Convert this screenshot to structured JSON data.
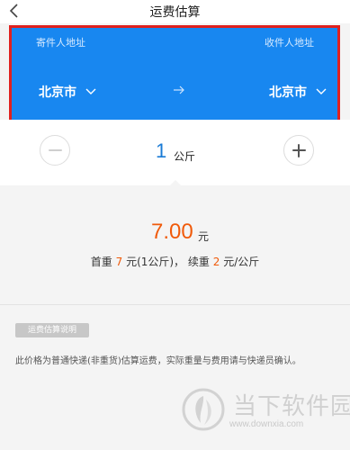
{
  "header": {
    "title": "运费估算"
  },
  "sender": {
    "label": "寄件人地址",
    "city": "北京市"
  },
  "receiver": {
    "label": "收件人地址",
    "city": "北京市"
  },
  "weight": {
    "value": "1",
    "unit": "公斤"
  },
  "result": {
    "price": "7.00",
    "price_unit": "元",
    "first_weight_label": "首重",
    "first_weight_price": "7",
    "first_weight_unit": "元(1公斤)，",
    "extra_weight_label": "续重",
    "extra_weight_price": "2",
    "extra_weight_unit": "元/公斤"
  },
  "notice": {
    "tag": "运费估算说明",
    "text": "此价格为普通快递(非重货)估算运费，实际重量与费用请与快递员确认。"
  },
  "watermark": {
    "title": "当下软件园",
    "url": "www.downxia.com"
  },
  "colors": {
    "accent": "#1887f0",
    "highlight": "#e0201e",
    "price": "#f05a0a",
    "weight": "#1a7bd6"
  },
  "icons": [
    "back-icon",
    "chevron-down-icon",
    "arrow-right-icon",
    "minus-icon",
    "plus-icon",
    "logo-icon"
  ]
}
